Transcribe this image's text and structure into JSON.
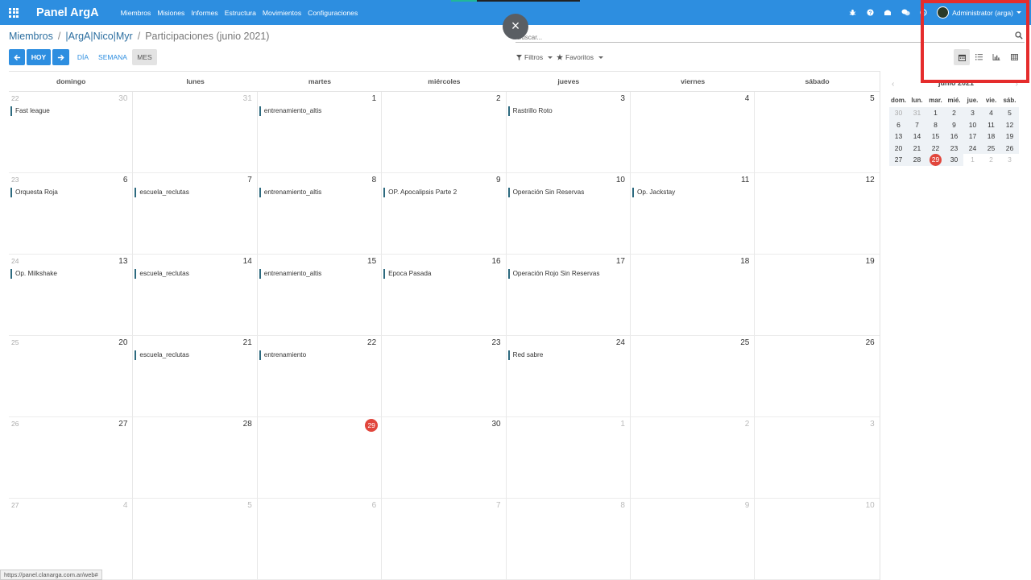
{
  "navbar": {
    "brand": "Panel ArgA",
    "menu": [
      "Miembros",
      "Misiones",
      "Informes",
      "Estructura",
      "Movimientos",
      "Configuraciones"
    ],
    "user": "Administrator (arga)",
    "color": "#2d8ee0"
  },
  "breadcrumb": {
    "items": [
      "Miembros",
      "|ArgA|Nico|Myr",
      "Participaciones (junio 2021)"
    ]
  },
  "search": {
    "placeholder": "Buscar..."
  },
  "controls": {
    "today": "HOY",
    "scales": [
      "DÍA",
      "SEMANA",
      "MES"
    ],
    "active_scale": "MES",
    "filters": "Filtros",
    "favorites": "Favoritos",
    "views": [
      "calendar-icon",
      "list-icon",
      "graph-icon",
      "pivot-icon"
    ],
    "active_view": "calendar-icon"
  },
  "calendar": {
    "weekdays": [
      "domingo",
      "lunes",
      "martes",
      "miércoles",
      "jueves",
      "viernes",
      "sábado"
    ],
    "weeks": [
      {
        "week": "22",
        "days": [
          {
            "d": "30",
            "muted": true,
            "event": "Fast league"
          },
          {
            "d": "31",
            "muted": true,
            "event": ""
          },
          {
            "d": "1",
            "event": "entrenamiento_altis"
          },
          {
            "d": "2",
            "event": ""
          },
          {
            "d": "3",
            "event": "Rastrillo Roto"
          },
          {
            "d": "4",
            "event": ""
          },
          {
            "d": "5",
            "event": ""
          }
        ]
      },
      {
        "week": "23",
        "days": [
          {
            "d": "6",
            "event": "Orquesta Roja"
          },
          {
            "d": "7",
            "event": "escuela_reclutas"
          },
          {
            "d": "8",
            "event": "entrenamiento_altis"
          },
          {
            "d": "9",
            "event": "OP. Apocalipsis Parte 2"
          },
          {
            "d": "10",
            "event": "Operación Sin Reservas"
          },
          {
            "d": "11",
            "event": "Op. Jackstay"
          },
          {
            "d": "12",
            "event": ""
          }
        ]
      },
      {
        "week": "24",
        "days": [
          {
            "d": "13",
            "event": "Op. Milkshake"
          },
          {
            "d": "14",
            "event": "escuela_reclutas"
          },
          {
            "d": "15",
            "event": "entrenamiento_altis"
          },
          {
            "d": "16",
            "event": "Epoca Pasada"
          },
          {
            "d": "17",
            "event": "Operación Rojo Sin Reservas"
          },
          {
            "d": "18",
            "event": ""
          },
          {
            "d": "19",
            "event": ""
          }
        ]
      },
      {
        "week": "25",
        "days": [
          {
            "d": "20",
            "event": ""
          },
          {
            "d": "21",
            "event": "escuela_reclutas"
          },
          {
            "d": "22",
            "event": "entrenamiento"
          },
          {
            "d": "23",
            "event": ""
          },
          {
            "d": "24",
            "event": "Red sabre"
          },
          {
            "d": "25",
            "event": ""
          },
          {
            "d": "26",
            "event": ""
          }
        ]
      },
      {
        "week": "26",
        "days": [
          {
            "d": "27",
            "event": ""
          },
          {
            "d": "28",
            "event": ""
          },
          {
            "d": "29",
            "today": true,
            "event": ""
          },
          {
            "d": "30",
            "event": ""
          },
          {
            "d": "1",
            "muted": true,
            "event": ""
          },
          {
            "d": "2",
            "muted": true,
            "event": ""
          },
          {
            "d": "3",
            "muted": true,
            "event": ""
          }
        ]
      },
      {
        "week": "27",
        "days": [
          {
            "d": "4",
            "muted": true,
            "event": ""
          },
          {
            "d": "5",
            "muted": true,
            "event": ""
          },
          {
            "d": "6",
            "muted": true,
            "event": ""
          },
          {
            "d": "7",
            "muted": true,
            "event": ""
          },
          {
            "d": "8",
            "muted": true,
            "event": ""
          },
          {
            "d": "9",
            "muted": true,
            "event": ""
          },
          {
            "d": "10",
            "muted": true,
            "event": ""
          }
        ]
      }
    ]
  },
  "mini_calendar": {
    "title": "junio 2021",
    "weekdays": [
      "dom.",
      "lun.",
      "mar.",
      "mié.",
      "jue.",
      "vie.",
      "sáb."
    ],
    "days": [
      [
        "30",
        "31",
        "1",
        "2",
        "3",
        "4",
        "5"
      ],
      [
        "6",
        "7",
        "8",
        "9",
        "10",
        "11",
        "12"
      ],
      [
        "13",
        "14",
        "15",
        "16",
        "17",
        "18",
        "19"
      ],
      [
        "20",
        "21",
        "22",
        "23",
        "24",
        "25",
        "26"
      ],
      [
        "27",
        "28",
        "29",
        "30",
        "1",
        "2",
        "3"
      ]
    ],
    "today": "29"
  },
  "status_url": "https://panel.clanarga.com.ar/web#"
}
